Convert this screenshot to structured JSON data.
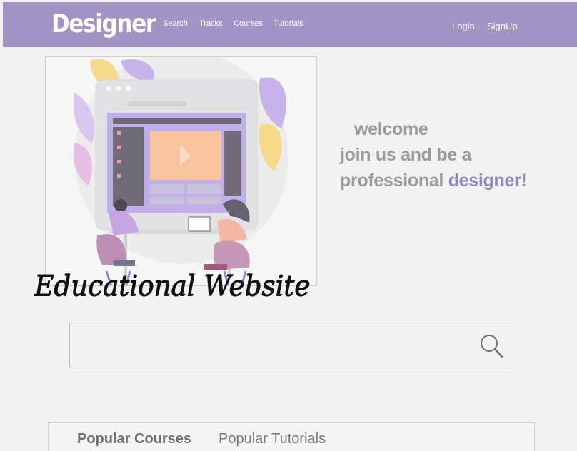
{
  "header": {
    "logo": "Designer",
    "nav": [
      "Search",
      "Tracks",
      "Courses",
      "Tutorials"
    ],
    "login": "Login",
    "signup": "SignUp"
  },
  "hero": {
    "welcome": "welcome",
    "line2": "join us and be a",
    "line3_prefix": "professional ",
    "line3_accent": "designer",
    "line3_suffix": "!"
  },
  "overlay_title": "Educational Website",
  "search": {
    "placeholder": "",
    "value": ""
  },
  "tabs": [
    "Popular Courses",
    "Popular Tutorials"
  ],
  "colors": {
    "nav_bg": "#a195c5",
    "accent": "#8f86b9",
    "text_gray": "#9b9b9b"
  }
}
